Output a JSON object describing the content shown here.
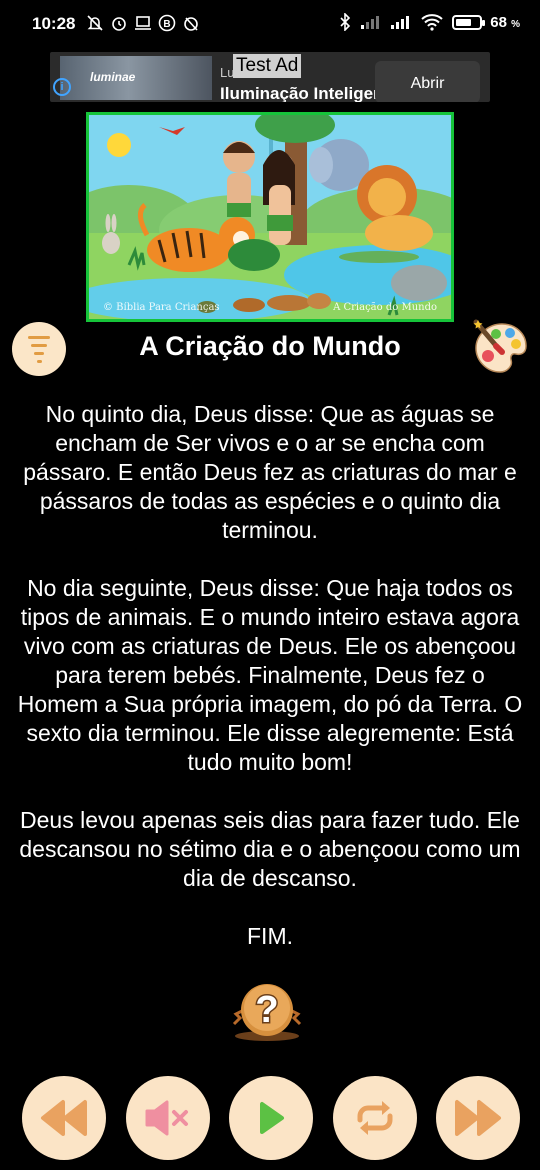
{
  "status_bar": {
    "time": "10:28",
    "left_icons": [
      "muted-bell-icon",
      "alarm-icon",
      "laptop-icon",
      "b-icon",
      "timer-icon"
    ],
    "right_icons": [
      "bluetooth-icon",
      "signal-icon",
      "signal-icon",
      "wifi-icon",
      "battery-icon"
    ],
    "battery_level": 0.68,
    "battery_text": "68",
    "battery_unit": "%"
  },
  "ad": {
    "test_tag": "Test Ad",
    "advertiser": "Luminae",
    "brand_logo": "luminae",
    "headline": "Iluminação Inteligente",
    "cta": "Abrir",
    "info_icon": "i"
  },
  "illustration": {
    "caption_left": "© Bíblia Para Crianças",
    "caption_right": "A Criação do Mundo"
  },
  "story": {
    "title": "A Criação do Mundo",
    "paragraphs": [
      "No quinto dia, Deus disse: Que as águas se encham de Ser vivos e o ar se encha com pássaro. E então Deus fez as criaturas do mar e pássaros de todas as espécies e o quinto dia terminou.",
      "No dia seguinte, Deus disse: Que haja todos os tipos de animais. E o mundo inteiro estava agora vivo com as criaturas de Deus. Ele os abençoou para terem bebés. Finalmente, Deus fez o Homem a Sua própria imagem, do pó da Terra. O sexto dia terminou. Ele disse alegremente: Está tudo muito bom!",
      "Deus levou apenas seis dias para fazer tudo. Ele descansou no sétimo dia e o abençoou como um dia de descanso.",
      "FIM."
    ]
  },
  "colors": {
    "accent": "#e9a260",
    "button_bg": "#fbe4c6",
    "play": "#5cc144",
    "mute": "#ef8fa0",
    "frame": "#16c43a"
  },
  "controls": [
    "rewind-icon",
    "sound-off-icon",
    "play-icon",
    "repeat-icon",
    "fast-forward-icon"
  ]
}
